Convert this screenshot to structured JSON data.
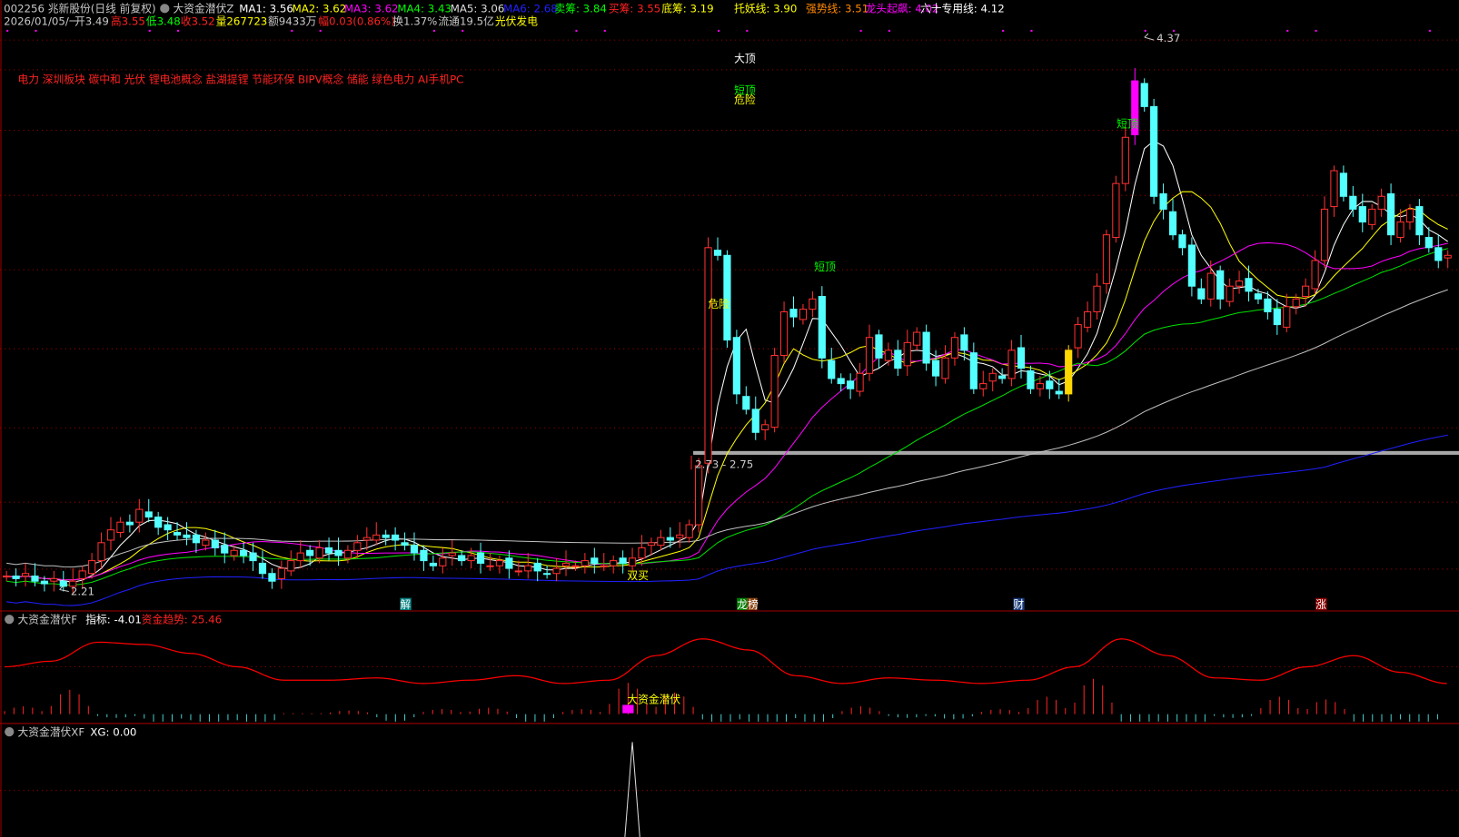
{
  "header": {
    "code_name": "002256 兆新股份(日线 前复权)",
    "indicator_name": "大资金潜伏Z",
    "ma1": "MA1: 3.56",
    "ma2": "MA2: 3.62",
    "ma3": "MA3: 3.62",
    "ma4": "MA4: 3.43",
    "ma5": "MA5: 3.06",
    "ma6": "MA6: 2.68",
    "sell": "卖筹: 3.84",
    "buy": "买筹: 3.55",
    "bottom": "底筹: 3.19",
    "tuoyao": "托妖线: 3.90",
    "qiangshi": "强势线: 3.51",
    "longtou": "龙头起飙: 4.02",
    "liushi": "六十专用线: 4.12"
  },
  "quote": {
    "date": "2026/01/05/一",
    "open": "开3.49",
    "high": "高3.55",
    "low": "低3.48",
    "close": "收3.52",
    "volume": "量267723",
    "amount": "额9433万",
    "change": "幅0.03(0.86%)",
    "turnover": "换1.37%",
    "float": "流通19.5亿",
    "sector": "光伏发电"
  },
  "concepts": "电力 深圳板块 碳中和 光伏 锂电池概念 盐湖提锂 节能环保 BIPV概念 储能 绿色电力 AI手机PC",
  "annotations": {
    "da_ding": "大顶",
    "duan_ding_1": "短顶",
    "wei_xian_1": "危险",
    "wei_xian_2": "危险",
    "duan_ding_2": "短顶",
    "duan_ding_3": "短顶",
    "high_label": "4.37",
    "low_label": "2.21",
    "shuang_mai": "双买",
    "zone_label": "2.73 - 2.75"
  },
  "event_markers": {
    "jie": "解",
    "long": "龙",
    "bang": "榜",
    "cai": "财",
    "zhang": "涨"
  },
  "panel2": {
    "name": "大资金潜伏F",
    "indicator": "指标: -4.01",
    "trend": "资金趋势: 25.46",
    "signal_label": "大资金潜伏"
  },
  "panel3": {
    "name": "大资金潜伏XF",
    "xg": "XG: 0.00"
  },
  "colors": {
    "up": "#ff3030",
    "down": "#54ffff",
    "ma1": "#ffffff",
    "ma2": "#ffff00",
    "ma3": "#ff00ff",
    "ma4": "#00e000",
    "ma5": "#c0c0c0",
    "ma6": "#2020ff",
    "grid": "#a00000"
  },
  "chart_data": {
    "type": "candlestick",
    "price_range": [
      2.21,
      4.37
    ],
    "closes": [
      2.27,
      2.26,
      2.28,
      2.25,
      2.24,
      2.26,
      2.23,
      2.25,
      2.29,
      2.33,
      2.4,
      2.45,
      2.48,
      2.47,
      2.53,
      2.5,
      2.46,
      2.45,
      2.43,
      2.42,
      2.4,
      2.41,
      2.38,
      2.36,
      2.37,
      2.35,
      2.33,
      2.28,
      2.25,
      2.3,
      2.33,
      2.36,
      2.35,
      2.38,
      2.36,
      2.35,
      2.37,
      2.4,
      2.42,
      2.43,
      2.42,
      2.41,
      2.39,
      2.36,
      2.33,
      2.31,
      2.34,
      2.36,
      2.33,
      2.35,
      2.32,
      2.31,
      2.33,
      2.3,
      2.29,
      2.31,
      2.29,
      2.28,
      2.3,
      2.32,
      2.31,
      2.33,
      2.32,
      2.31,
      2.33,
      2.32,
      2.34,
      2.38,
      2.4,
      2.42,
      2.41,
      2.43,
      2.47,
      2.7,
      3.55,
      3.52,
      3.19,
      2.98,
      2.92,
      2.83,
      2.86,
      3.13,
      3.3,
      3.28,
      3.31,
      3.35,
      3.12,
      3.04,
      3.02,
      3.0,
      3.06,
      3.2,
      3.12,
      3.15,
      3.08,
      3.18,
      3.22,
      3.1,
      3.05,
      3.12,
      3.2,
      3.15,
      3.0,
      3.02,
      3.06,
      3.04,
      3.15,
      3.08,
      3.0,
      3.02,
      3.0,
      2.98,
      3.15,
      3.25,
      3.3,
      3.4,
      3.6,
      3.8,
      3.98,
      4.2,
      4.1,
      3.75,
      3.7,
      3.6,
      3.55,
      3.4,
      3.35,
      3.45,
      3.35,
      3.4,
      3.42,
      3.38,
      3.35,
      3.3,
      3.25,
      3.32,
      3.35,
      3.4,
      3.5,
      3.7,
      3.85,
      3.75,
      3.7,
      3.65,
      3.7,
      3.75,
      3.6,
      3.65,
      3.7,
      3.6,
      3.55,
      3.5,
      3.52
    ],
    "highlight_yellow_index": 112,
    "highlight_magenta_index": 119,
    "fund_trend": [
      0,
      5,
      22,
      20,
      12,
      0,
      -12,
      -12,
      -10,
      -15,
      -12,
      -8,
      -15,
      -12,
      10,
      25,
      15,
      -8,
      -15,
      -10,
      -12,
      -15,
      -12,
      0,
      25,
      10,
      -10,
      -12,
      0,
      10,
      -5,
      -15
    ],
    "xg_signal_index": 66
  }
}
